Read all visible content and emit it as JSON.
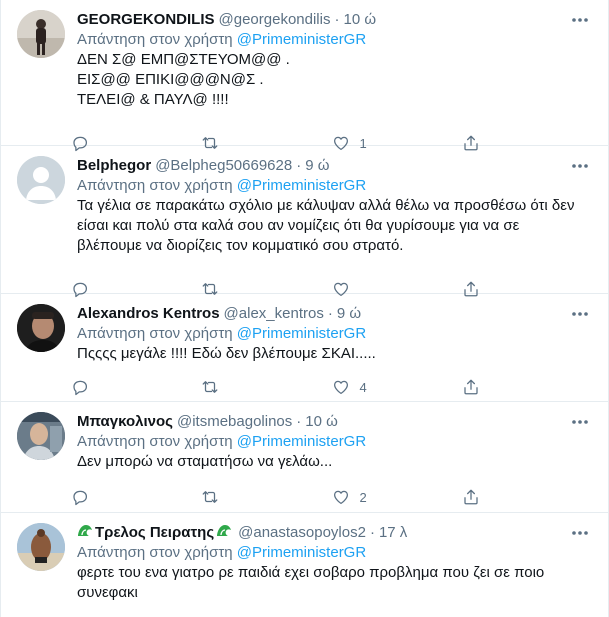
{
  "reply_prefix": "Απάντηση στον χρήστη",
  "dot": "·",
  "tweets": [
    {
      "name": "GEORGEKONDILIS",
      "handle": "@georgekondilis",
      "time": "10 ώ",
      "reply_to": "@PrimeministerGR",
      "text": "ΔΕΝ Σ@ ΕΜΠ@ΣΤΕΥΟΜ@@ .\nΕΙΣ@@ ΕΠΙΚΙ@@@Ν@Σ .\nΤΕΛΕΙ@ & ΠΑΥΛ@ !!!!",
      "reply_count": "",
      "retweet_count": "",
      "like_count": "1"
    },
    {
      "name": "Belphegor",
      "handle": "@Belpheg50669628",
      "time": "9 ώ",
      "reply_to": "@PrimeministerGR",
      "text": "Τα γέλια σε παρακάτω σχόλιο με κάλυψαν αλλά θέλω να προσθέσω ότι δεν είσαι και πολύ στα καλά σου αν νομίζεις ότι θα γυρίσουμε για να σε βλέπουμε να διορίζεις τον κομματικό σου στρατό.",
      "reply_count": "",
      "retweet_count": "",
      "like_count": ""
    },
    {
      "name": "Alexandros Kentros",
      "handle": "@alex_kentros",
      "time": "9 ώ",
      "reply_to": "@PrimeministerGR",
      "text": "Πςςςς μεγάλε !!!! Εδώ δεν βλέπουμε ΣΚΑΙ.....",
      "reply_count": "",
      "retweet_count": "",
      "like_count": "4"
    },
    {
      "name": "Μπαγκολινος",
      "handle": "@itsmebagolinos",
      "time": "10 ώ",
      "reply_to": "@PrimeministerGR",
      "text": "Δεν μπορώ να σταματήσω να γελάω...",
      "reply_count": "",
      "retweet_count": "",
      "like_count": "2"
    },
    {
      "name": "Τρελος Πειρατης",
      "handle": "@anastasopoylos2",
      "time": "17 λ",
      "reply_to": "@PrimeministerGR",
      "text": "φερτε του ενα γιατρο ρε παιδιά εχει σοβαρο προβλημα που ζει σε ποιο συνεφακι",
      "reply_count": "",
      "retweet_count": "",
      "like_count": ""
    }
  ],
  "icons": {
    "reply": "reply-icon",
    "retweet": "retweet-icon",
    "like": "like-icon",
    "share": "share-icon",
    "more": "more-icon",
    "name_emoji": "wave-emoji-icon"
  },
  "colors": {
    "link": "#1da1f2",
    "muted": "#5b7083",
    "text": "#0f1419",
    "border": "#e6ecf0",
    "emoji_green": "#2fa84a"
  }
}
